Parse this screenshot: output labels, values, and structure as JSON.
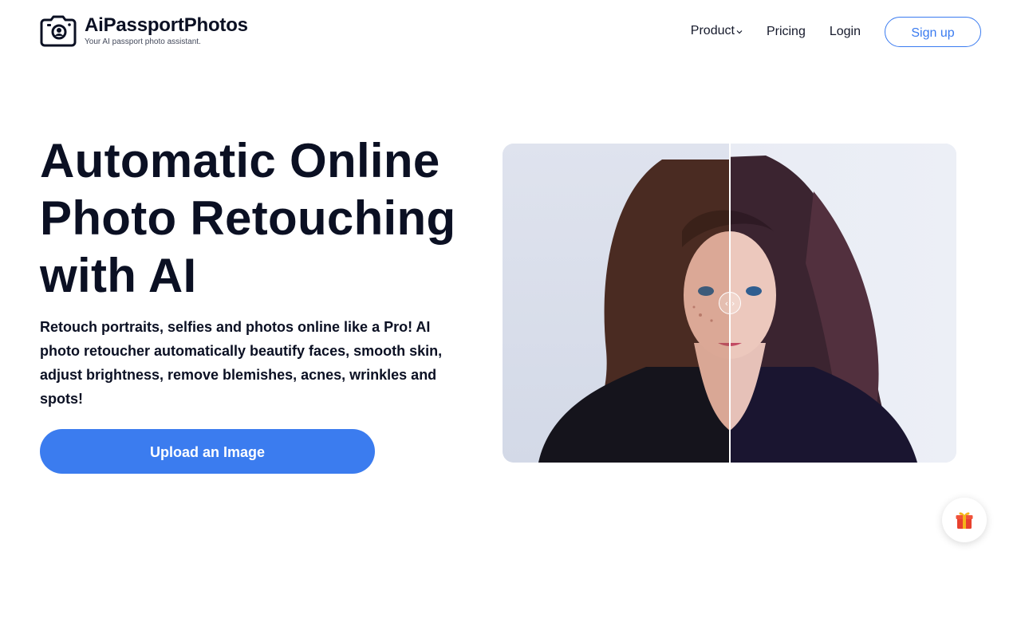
{
  "brand": {
    "name": "AiPassportPhotos",
    "tagline": "Your AI passport photo assistant.",
    "logo_icon": "camera-portrait-icon"
  },
  "nav": {
    "product": "Product",
    "pricing": "Pricing",
    "login": "Login",
    "signup": "Sign up"
  },
  "hero": {
    "title": "Automatic Online Photo Retouching with AI",
    "description": "Retouch portraits, selfies and photos online like a Pro! AI photo retoucher automatically beautify faces, smooth skin, adjust brightness, remove blemishes, acnes, wrinkles and spots!",
    "cta": "Upload an Image"
  },
  "compare": {
    "handle_left": "‹",
    "handle_right": "›",
    "handle_icon": "compare-slider-icon"
  },
  "floating": {
    "gift_icon": "gift-icon"
  },
  "colors": {
    "accent": "#3b7cef",
    "text": "#0b1023",
    "gift_red": "#e8412e",
    "gift_ribbon": "#f5b41a"
  }
}
